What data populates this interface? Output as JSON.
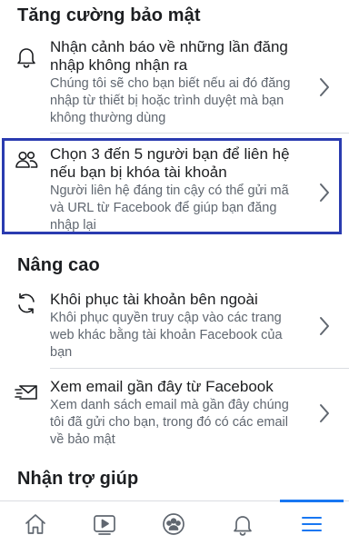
{
  "sections": {
    "security": {
      "title": "Tăng cường bảo mật"
    },
    "advanced": {
      "title": "Nâng cao"
    },
    "help": {
      "title": "Nhận trợ giúp"
    }
  },
  "items": [
    {
      "title_lines": [
        "Nhận cảnh báo về những lần đăng",
        "nhập không nhận ra"
      ],
      "desc_lines": [
        "Chúng tôi sẽ cho bạn biết nếu ai đó đăng",
        "nhập từ thiết bị hoặc trình duyệt mà bạn",
        "không thường dùng"
      ],
      "icon": "bell-icon"
    },
    {
      "title_lines": [
        "Chọn 3 đến 5 người bạn để liên hệ",
        "nếu bạn bị khóa tài khoản"
      ],
      "desc_lines": [
        "Người liên hệ đáng tin cậy có thể gửi mã",
        "và URL từ Facebook để giúp bạn đăng",
        "nhập lại"
      ],
      "icon": "friends-icon",
      "highlighted": true
    },
    {
      "title_lines": [
        "Khôi phục tài khoản bên ngoài"
      ],
      "desc_lines": [
        "Khôi phục quyền truy cập vào các trang",
        "web khác bằng tài khoản Facebook của",
        "bạn"
      ],
      "icon": "refresh-icon"
    },
    {
      "title_lines": [
        "Xem email gần đây từ Facebook"
      ],
      "desc_lines": [
        "Xem danh sách email mà gần đây chúng",
        "tôi đã gửi cho bạn, trong đó có các email",
        "về bảo mật"
      ],
      "icon": "email-icon"
    }
  ],
  "tabbar": {
    "tabs": [
      "home-icon",
      "watch-icon",
      "groups-icon",
      "notifications-icon",
      "menu-icon"
    ],
    "active": "menu-icon",
    "accent": "#1877f2"
  },
  "colors": {
    "title": "#1c1e21",
    "desc": "#606770",
    "highlight_border": "#2a3bb0"
  }
}
